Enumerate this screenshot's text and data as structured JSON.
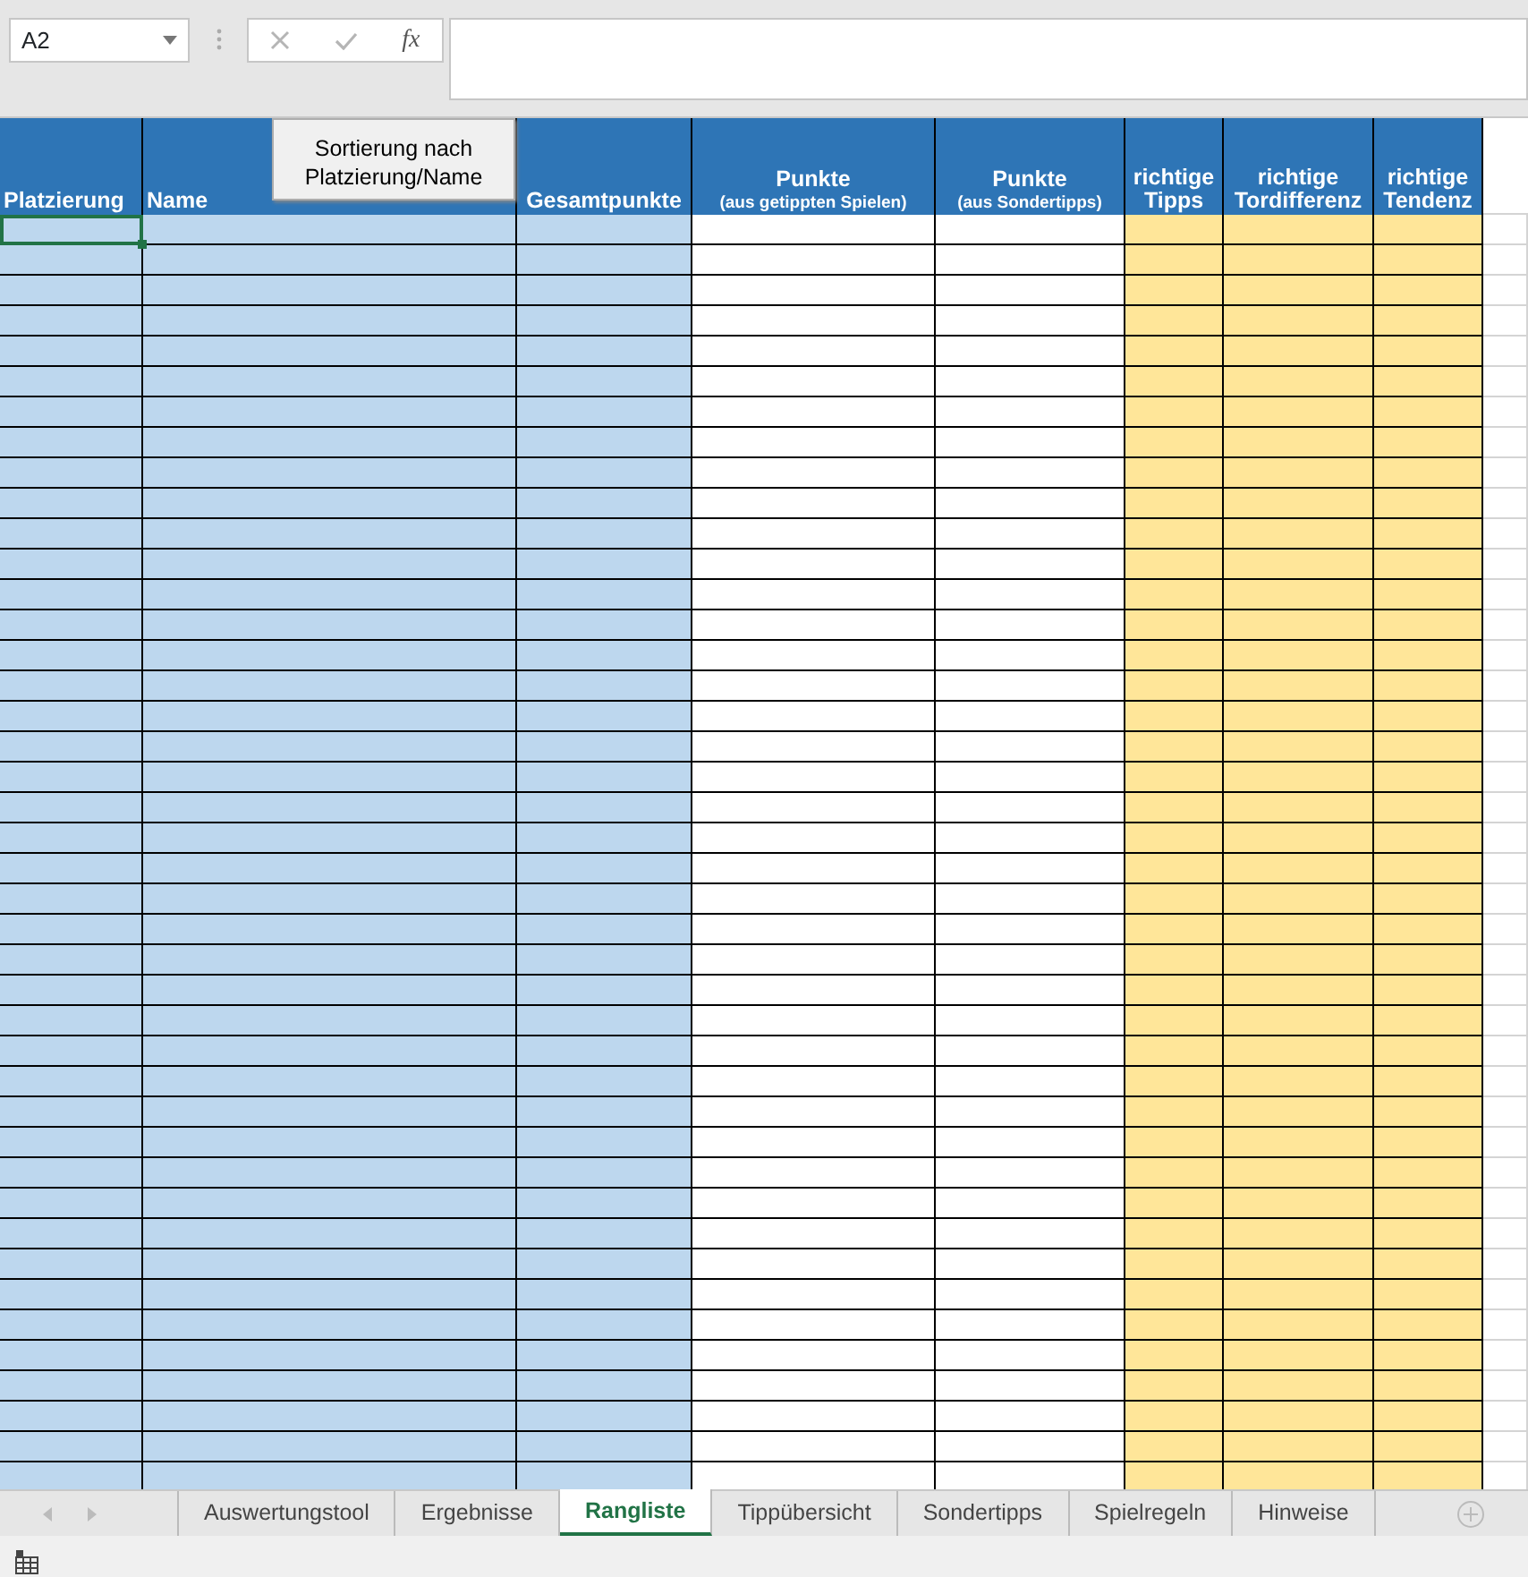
{
  "name_box": {
    "value": "A2"
  },
  "formula_bar": {
    "function_label": "fx"
  },
  "sort_button": {
    "label": "Sortierung nach Platzierung/Name"
  },
  "table": {
    "columns": [
      {
        "title": "Platzierung",
        "color": "#bdd7ee",
        "selected": true
      },
      {
        "title": "Name",
        "color": "#bdd7ee",
        "selected": false
      },
      {
        "title": "Gesamtpunkte",
        "color": "#bdd7ee",
        "selected": false
      },
      {
        "title": "Punkte",
        "subtitle": "(aus getippten Spielen)",
        "color": "#ffffff",
        "selected": false
      },
      {
        "title": "Punkte",
        "subtitle": "(aus Sondertipps)",
        "color": "#ffffff",
        "selected": false
      },
      {
        "title": "richtige Tipps",
        "color": "#ffe699",
        "selected": false
      },
      {
        "title": "richtige Tordifferenz",
        "color": "#ffe699",
        "selected": false
      },
      {
        "title": "richtige Tendenz",
        "color": "#ffe699",
        "selected": false
      }
    ]
  },
  "sheet_tabs": [
    {
      "label": "Auswertungstool",
      "selected": false
    },
    {
      "label": "Ergebnisse",
      "selected": false
    },
    {
      "label": "Rangliste",
      "selected": true
    },
    {
      "label": "Tippübersicht",
      "selected": false
    },
    {
      "label": "Sondertipps",
      "selected": false
    },
    {
      "label": "Spielregeln",
      "selected": false
    },
    {
      "label": "Hinweise",
      "selected": false
    }
  ]
}
